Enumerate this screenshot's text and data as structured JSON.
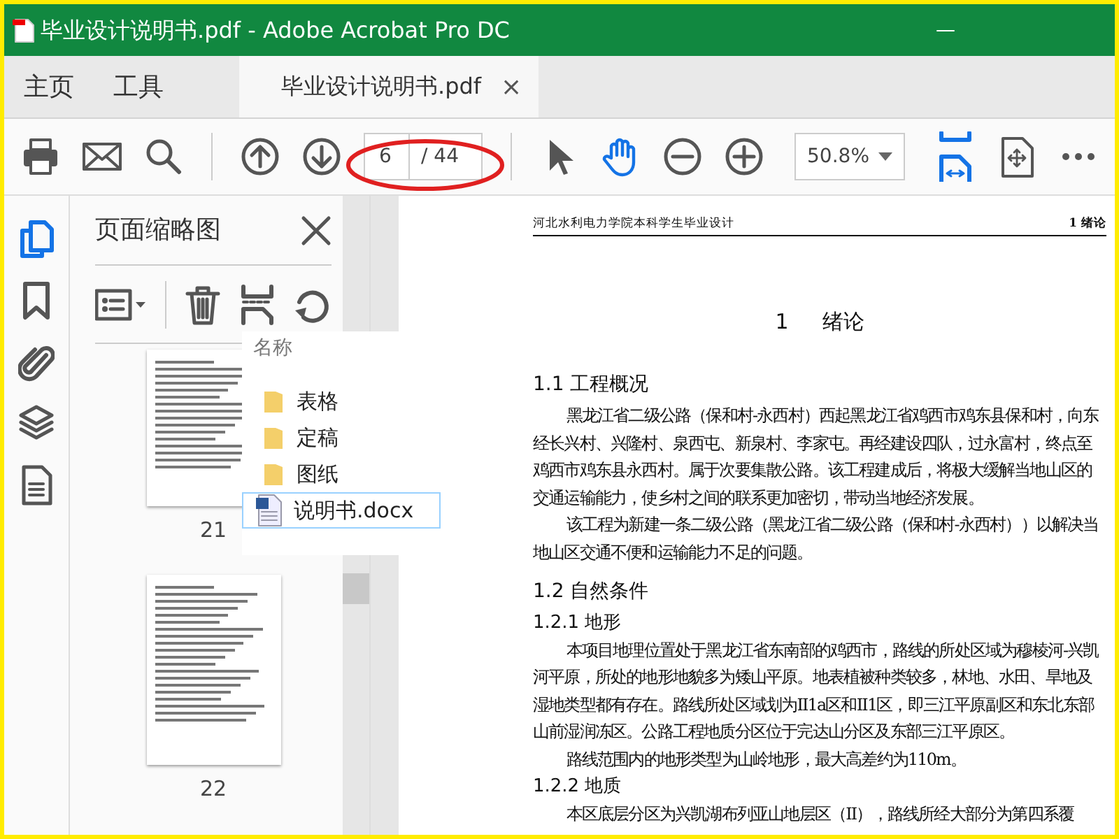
{
  "window": {
    "title": "毕业设计说明书.pdf - Adobe Acrobat Pro DC"
  },
  "tabs": [
    {
      "label": "主页",
      "selected": false
    },
    {
      "label": "工具",
      "selected": false
    },
    {
      "label": "毕业设计说明书.pdf",
      "selected": true,
      "close": "×"
    }
  ],
  "toolbar": {
    "page_current": "6",
    "page_total": "/ 44",
    "zoom": "50.8%",
    "tools": [
      {
        "kind": "select",
        "selected": false
      },
      {
        "kind": "hand",
        "selected": true
      }
    ]
  },
  "sidebar": {
    "items": [
      {
        "kind": "pages",
        "selected": true
      },
      {
        "kind": "bookmarks",
        "selected": false
      },
      {
        "kind": "attachments",
        "selected": false
      },
      {
        "kind": "layers",
        "selected": false
      },
      {
        "kind": "content",
        "selected": false
      }
    ]
  },
  "thumbnail_panel": {
    "title": "页面缩略图",
    "thumbnails": [
      {
        "page": "21"
      },
      {
        "page": "22"
      }
    ]
  },
  "drag_popup": {
    "header": "名称",
    "items": [
      {
        "kind": "folder",
        "name": "表格",
        "selected": false
      },
      {
        "kind": "folder",
        "name": "定稿",
        "selected": false
      },
      {
        "kind": "folder",
        "name": "图纸",
        "selected": false
      },
      {
        "kind": "docx",
        "name": "说明书.docx",
        "selected": true
      }
    ]
  },
  "document": {
    "header_left": "河北水利电力学院本科学生毕业设计",
    "header_right": "1 绪论",
    "chapter_number": "1",
    "chapter_title": "绪论",
    "blocks": [
      {
        "kind": "h2",
        "text": "1.1 工程概况"
      },
      {
        "kind": "p",
        "text": "黑龙江省二级公路（保和村-永西村）西起黑龙江省鸡西市鸡东县保和村，向东经长兴村、兴隆村、泉西屯、新泉村、李家屯。再经建设四队，过永富村，终点至鸡西市鸡东县永西村。属于次要集散公路。该工程建成后，将极大缓解当地山区的交通运输能力，使乡村之间的联系更加密切，带动当地经济发展。"
      },
      {
        "kind": "p",
        "text": "该工程为新建一条二级公路（黑龙江省二级公路（保和村-永西村））以解决当地山区交通不便和运输能力不足的问题。"
      },
      {
        "kind": "h2",
        "text": "1.2 自然条件"
      },
      {
        "kind": "h3",
        "text": "1.2.1 地形"
      },
      {
        "kind": "p",
        "text": "本项目地理位置处于黑龙江省东南部的鸡西市，路线的所处区域为穆棱河-兴凯河平原，所处的地形地貌多为矮山平原。地表植被种类较多，林地、水田、旱地及湿地类型都有存在。路线所处区域划为II1a区和II1区，即三江平原副区和东北东部山前湿润冻区。公路工程地质分区位于完达山分区及东部三江平原区。"
      },
      {
        "kind": "p",
        "text": "路线范围内的地形类型为山岭地形，最大高差约为110m。"
      },
      {
        "kind": "h3",
        "text": "1.2.2 地质"
      },
      {
        "kind": "p",
        "text": "本区底层分区为兴凯湖布列亚山地层区（II），路线所经大部分为第四系覆"
      }
    ]
  }
}
